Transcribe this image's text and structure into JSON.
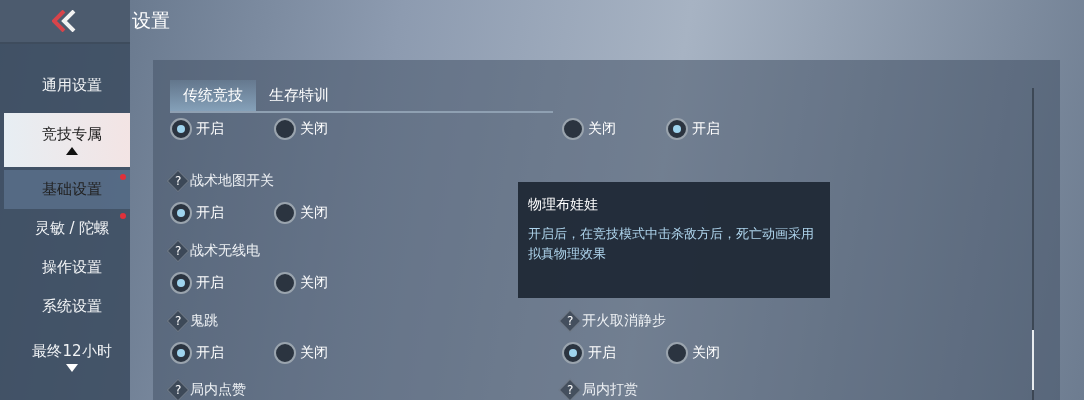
{
  "header": {
    "title": "设置"
  },
  "sidebar": {
    "items": [
      {
        "label": "通用设置",
        "selected": false,
        "dot": false
      },
      {
        "label": "竞技专属",
        "selected": true,
        "dot": false,
        "expanded": true,
        "children": [
          {
            "label": "基础设置",
            "selected": true,
            "dot": true
          },
          {
            "label": "灵敏 / 陀螺",
            "selected": false,
            "dot": true
          },
          {
            "label": "操作设置",
            "selected": false,
            "dot": false
          },
          {
            "label": "系统设置",
            "selected": false,
            "dot": false
          }
        ]
      },
      {
        "label": "最终12小时",
        "selected": false,
        "dot": false,
        "expanded": false
      }
    ]
  },
  "tabs": [
    {
      "label": "传统竞技",
      "selected": true
    },
    {
      "label": "生存特训",
      "selected": false
    }
  ],
  "rows": [
    {
      "left": {
        "options": [
          {
            "label": "开启",
            "selected": true
          },
          {
            "label": "关闭",
            "selected": false
          }
        ]
      },
      "right": {
        "options": [
          {
            "label": "关闭",
            "selected": false
          },
          {
            "label": "开启",
            "selected": true
          }
        ]
      }
    },
    {
      "left": {
        "help": "?",
        "label": "战术地图开关",
        "options": [
          {
            "label": "开启",
            "selected": true
          },
          {
            "label": "关闭",
            "selected": false
          }
        ]
      }
    },
    {
      "left": {
        "help": "?",
        "label": "战术无线电",
        "options": [
          {
            "label": "开启",
            "selected": true
          },
          {
            "label": "关闭",
            "selected": false
          }
        ]
      }
    },
    {
      "left": {
        "help": "?",
        "label": "鬼跳",
        "options": [
          {
            "label": "开启",
            "selected": true
          },
          {
            "label": "关闭",
            "selected": false
          }
        ]
      },
      "right": {
        "help": "?",
        "label": "开火取消静步",
        "options": [
          {
            "label": "开启",
            "selected": true
          },
          {
            "label": "关闭",
            "selected": false
          }
        ]
      }
    },
    {
      "left": {
        "help": "?",
        "label": "局内点赞"
      },
      "right": {
        "help": "?",
        "label": "局内打赏"
      }
    }
  ],
  "tooltip": {
    "title": "物理布娃娃",
    "text": "开启后，在竞技模式中击杀敌方后，死亡动画采用拟真物理效果"
  }
}
